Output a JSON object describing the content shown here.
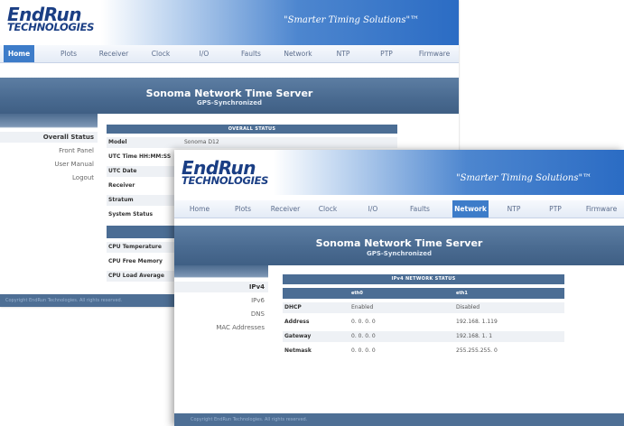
{
  "back_window": {
    "logo": {
      "line1": "EndRun",
      "line2": "TECHNOLOGIES"
    },
    "slogan": "\"Smarter Timing Solutions\"™",
    "nav": [
      "Home",
      "Plots",
      "Receiver",
      "Clock",
      "I/O",
      "Faults",
      "Network",
      "NTP",
      "PTP",
      "Firmware"
    ],
    "active_tab": "Home",
    "title": "Sonoma Network Time Server",
    "subtitle": "GPS-Synchronized",
    "sidebar": [
      "Overall Status",
      "Front Panel",
      "User Manual",
      "Logout"
    ],
    "panel_title": "OVERALL STATUS",
    "rows": [
      {
        "label": "Model",
        "value": "Sonoma D12"
      },
      {
        "label": "UTC Time HH:MM:SS",
        "value": ""
      },
      {
        "label": "UTC Date",
        "value": ""
      },
      {
        "label": "Receiver",
        "value": ""
      },
      {
        "label": "Stratum",
        "value": ""
      },
      {
        "label": "System Status",
        "value": ""
      },
      {
        "label": "CPU Temperature",
        "value": ""
      },
      {
        "label": "CPU Free Memory",
        "value": ""
      },
      {
        "label": "CPU Load Average",
        "value": ""
      }
    ],
    "footer": "Copyright EndRun Technologies. All rights reserved."
  },
  "front_window": {
    "logo": {
      "line1": "EndRun",
      "line2": "TECHNOLOGIES"
    },
    "slogan": "\"Smarter Timing Solutions\"™",
    "nav": [
      "Home",
      "Plots",
      "Receiver",
      "Clock",
      "I/O",
      "Faults",
      "Network",
      "NTP",
      "PTP",
      "Firmware"
    ],
    "active_tab": "Network",
    "title": "Sonoma Network Time Server",
    "subtitle": "GPS-Synchronized",
    "sidebar": [
      "IPv4",
      "IPv6",
      "DNS",
      "MAC Addresses"
    ],
    "panel_title": "IPv4 NETWORK STATUS",
    "columns": [
      "",
      "eth0",
      "eth1"
    ],
    "rows": [
      {
        "label": "DHCP",
        "eth0": "Enabled",
        "eth1": "Disabled"
      },
      {
        "label": "Address",
        "eth0": "0. 0. 0. 0",
        "eth1": "192.168. 1.119"
      },
      {
        "label": "Gateway",
        "eth0": "0. 0. 0. 0",
        "eth1": "192.168. 1. 1"
      },
      {
        "label": "Netmask",
        "eth0": "0. 0. 0. 0",
        "eth1": "255.255.255. 0"
      }
    ],
    "footer": "Copyright EndRun Technologies. All rights reserved."
  }
}
